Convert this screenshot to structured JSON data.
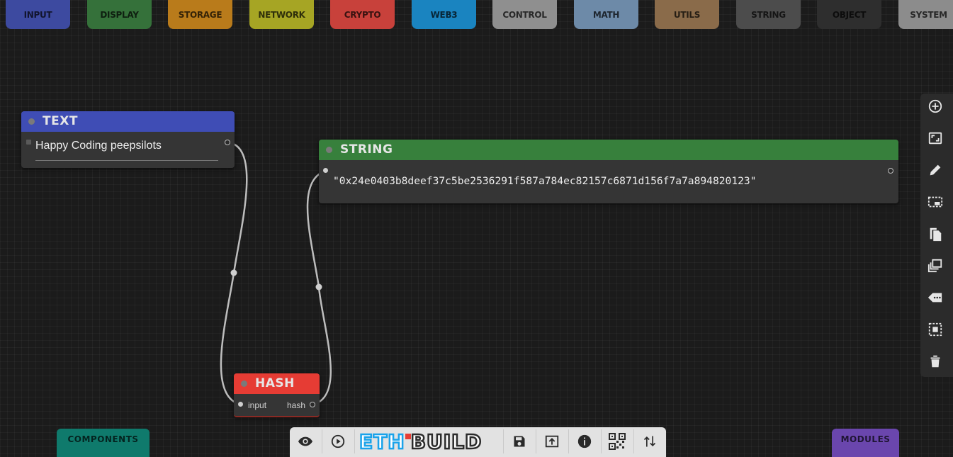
{
  "categories": [
    {
      "label": "INPUT",
      "color": "#3d4aa0"
    },
    {
      "label": "DISPLAY",
      "color": "#35713a"
    },
    {
      "label": "STORAGE",
      "color": "#b97b1b"
    },
    {
      "label": "NETWORK",
      "color": "#a6a524"
    },
    {
      "label": "CRYPTO",
      "color": "#c8413b"
    },
    {
      "label": "WEB3",
      "color": "#1a84c0"
    },
    {
      "label": "CONTROL",
      "color": "#8f8f8f"
    },
    {
      "label": "MATH",
      "color": "#6d8aa8"
    },
    {
      "label": "UTILS",
      "color": "#8a6b4a"
    },
    {
      "label": "STRING",
      "color": "#4c4c4c"
    },
    {
      "label": "OBJECT",
      "color": "#2e2e2e"
    },
    {
      "label": "SYSTEM",
      "color": "#8c8c8c"
    }
  ],
  "nodes": {
    "text": {
      "title": "TEXT",
      "value": "Happy Coding peepsilots",
      "color": "#3f4db5"
    },
    "string": {
      "title": "STRING",
      "value": "\"0x24e0403b8deef37c5be2536291f587a784ec82157c6871d156f7a7a894820123\"",
      "color": "#37803c"
    },
    "hash": {
      "title": "HASH",
      "input_label": "input",
      "output_label": "hash",
      "color": "#e63c34"
    }
  },
  "toolbar": [
    "add-icon",
    "fit-view-icon",
    "edit-icon",
    "select-region-icon",
    "copy-icon",
    "duplicate-icon",
    "label-icon",
    "select-all-icon",
    "delete-icon"
  ],
  "bottom_bar": {
    "logo_left": "ETH",
    "logo_right": "BUILD",
    "buttons": [
      "eye-icon",
      "play-icon",
      "save-icon",
      "upload-icon",
      "info-icon",
      "qr-code-icon",
      "swap-icon"
    ]
  },
  "tabs": {
    "components": "COMPONENTS",
    "modules": "MODULES"
  },
  "colors": {
    "components_tab": "#0f7a6c",
    "modules_tab": "#6a46ad",
    "bottom_bar": "#e2e2e2",
    "logo_blue": "#1aa3ea",
    "logo_dark": "#2b2b2b",
    "logo_red": "#e63c34"
  }
}
